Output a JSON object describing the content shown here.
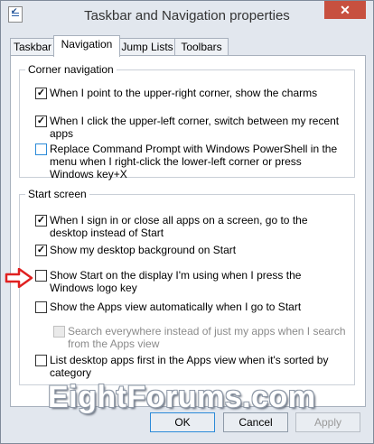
{
  "window": {
    "title": "Taskbar and Navigation properties",
    "close_label": "✕"
  },
  "tabs": [
    {
      "label": "Taskbar"
    },
    {
      "label": "Navigation"
    },
    {
      "label": "Jump Lists"
    },
    {
      "label": "Toolbars"
    }
  ],
  "corner_navigation": {
    "title": "Corner navigation",
    "items": [
      {
        "label": "When I point to the upper-right corner, show the charms",
        "checked": true
      },
      {
        "label": "When I click the upper-left corner, switch between my recent apps",
        "checked": true
      },
      {
        "label": "Replace Command Prompt with Windows PowerShell in the menu when I right-click the lower-left corner or press Windows key+X",
        "checked": false
      }
    ]
  },
  "start_screen": {
    "title": "Start screen",
    "items": [
      {
        "label": "When I sign in or close all apps on a screen, go to the desktop instead of Start",
        "checked": true
      },
      {
        "label": "Show my desktop background on Start",
        "checked": true
      },
      {
        "label": "Show Start on the display I'm using when I press the Windows logo key",
        "checked": false
      },
      {
        "label": "Show the Apps view automatically when I go to Start",
        "checked": false
      },
      {
        "label": "Search everywhere instead of just my apps when I search from the Apps view",
        "checked": false
      },
      {
        "label": "List desktop apps first in the Apps view when it's sorted by category",
        "checked": false
      }
    ]
  },
  "watermark": "EightForums.com",
  "buttons": {
    "ok": "OK",
    "cancel": "Cancel",
    "apply": "Apply"
  },
  "colors": {
    "arrow": "#e02020",
    "focus_blue": "#2b8ad8",
    "close": "#c7503f"
  }
}
